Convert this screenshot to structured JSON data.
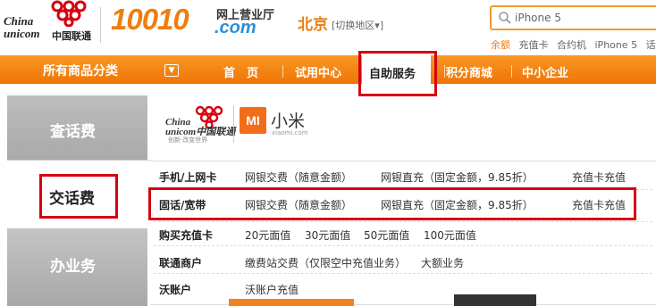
{
  "header": {
    "logo_en_line1": "China",
    "logo_en_line2": "unicom",
    "logo_cn": "中国联通",
    "brand_number": "10010",
    "brand_sub": "网上营业厅",
    "brand_domain": ".com",
    "city": "北京",
    "switch_area": "[切换地区▾]",
    "search_placeholder": "iPhone 5",
    "hot_links": [
      "余额",
      "充值卡",
      "合约机",
      "iPhone 5",
      "话费"
    ]
  },
  "nav": {
    "category_label": "所有商品分类",
    "items": [
      {
        "label": "首　页"
      },
      {
        "label": "试用中心"
      },
      {
        "label": "自助服务"
      },
      {
        "label": "积分商城"
      },
      {
        "label": "中小企业"
      }
    ]
  },
  "left_tabs": {
    "tab1": "查话费",
    "tab2": "交话费",
    "tab3": "办业务"
  },
  "banner": {
    "logo_en_line1": "China",
    "logo_en_line2": "unicom中国联通",
    "slogan": "创新·改变世界",
    "mi_mark": "MI",
    "mi_text": "小米",
    "mi_sub": "xiaomi.com"
  },
  "rows": [
    {
      "label": "手机/上网卡",
      "options": [
        "网银交费（随意金额）",
        "网银直充（固定金额，9.85折）",
        "充值卡充值"
      ]
    },
    {
      "label": "固话/宽带",
      "options": [
        "网银交费（随意金额）",
        "网银直充（固定金额，9.85折）",
        "充值卡充值"
      ]
    },
    {
      "label": "购买充值卡",
      "options": [
        "20元面值",
        "30元面值",
        "50元面值",
        "100元面值"
      ]
    },
    {
      "label": "联通商户",
      "options": [
        "缴费站交费（仅限空中充值业务）",
        "大额业务"
      ]
    },
    {
      "label": "沃账户",
      "options": [
        "沃账户充值"
      ]
    }
  ],
  "colors": {
    "brand_orange": "#ef7d10",
    "highlight_red": "#d50010",
    "domain_blue": "#2a8fd8"
  }
}
